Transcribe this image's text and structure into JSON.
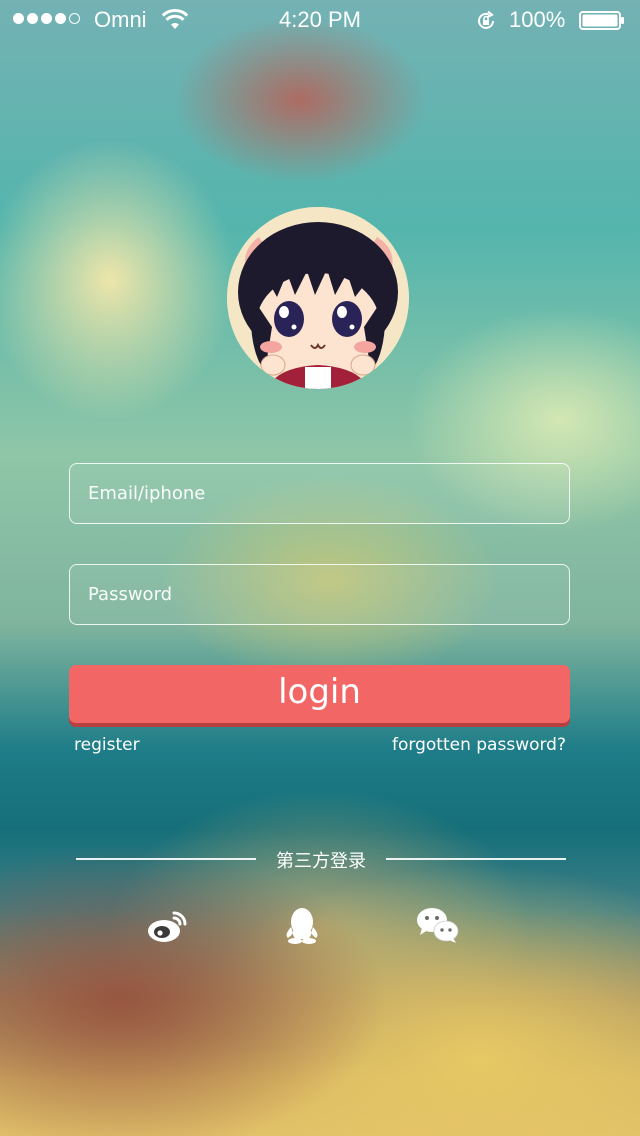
{
  "status_bar": {
    "carrier": "Omni",
    "time": "4:20 PM",
    "battery": "100%"
  },
  "login_form": {
    "email_placeholder": "Email/iphone",
    "password_placeholder": "Password",
    "login_label": "login",
    "register_label": "register",
    "forgot_label": "forgotten password?"
  },
  "third_party": {
    "label": "第三方登录",
    "icons": [
      "weibo-icon",
      "qq-icon",
      "wechat-icon"
    ]
  },
  "colors": {
    "login_button": "#f36666",
    "text": "#ffffff"
  }
}
